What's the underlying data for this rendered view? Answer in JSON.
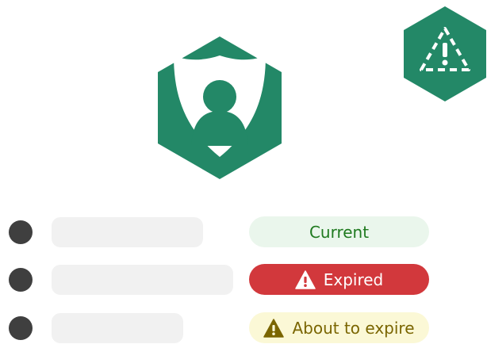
{
  "colors": {
    "brand_green": "#238867",
    "dot": "#3f3f3f",
    "placeholder_bar": "#f1f1f1",
    "current_bg": "#eaf6ec",
    "current_text": "#1f7a1f",
    "expired_bg": "#d2383c",
    "expired_text": "#ffffff",
    "expire_soon_bg": "#fbf8d6",
    "expire_soon_text": "#7a6500"
  },
  "icons": {
    "main": "shield-person-icon",
    "corner": "alert-warning-icon",
    "expired": "warning-triangle-icon",
    "expire_soon": "warning-triangle-icon"
  },
  "statuses": [
    {
      "label": "Current",
      "state": "current"
    },
    {
      "label": "Expired",
      "state": "expired"
    },
    {
      "label": "About to expire",
      "state": "expire-soon"
    }
  ]
}
